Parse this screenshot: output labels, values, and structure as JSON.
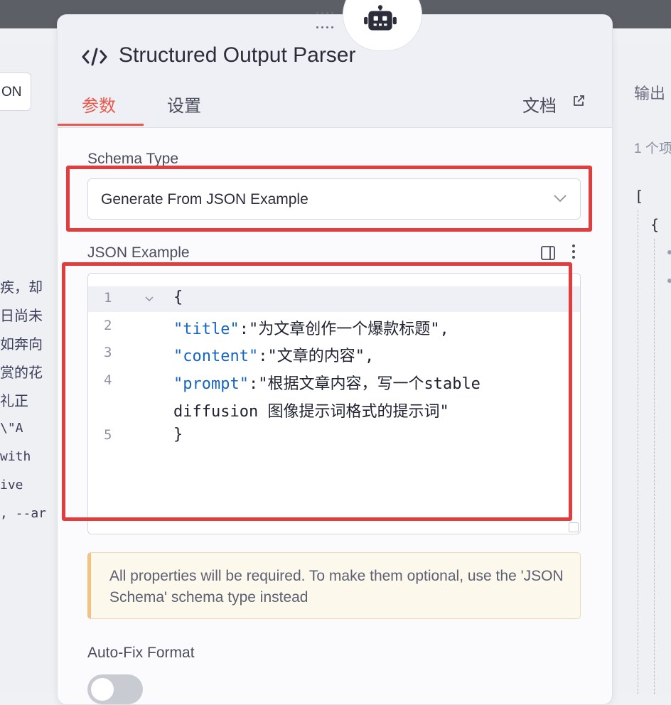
{
  "background": {
    "left_field_value": "ON",
    "left_text_lines": [
      "疾，却",
      "日尚未",
      "如奔向",
      "赏的花",
      "礼正",
      "\\\"A",
      "with",
      "ive",
      ", --ar"
    ],
    "right_panel_title": "输出",
    "right_panel_subtitle": "1 个项",
    "right_open_bracket": "[",
    "right_open_brace": "{"
  },
  "panel": {
    "title": "Structured Output Parser",
    "title_icon": "code-icon",
    "node_icon": "robot-icon",
    "tabs": [
      {
        "label": "参数",
        "active": true
      },
      {
        "label": "设置",
        "active": false
      }
    ],
    "docs_label": "文档",
    "docs_icon": "external-link-icon"
  },
  "schema_type": {
    "label": "Schema Type",
    "selected": "Generate From JSON Example"
  },
  "json_example": {
    "label": "JSON Example",
    "lines": [
      {
        "num": "1",
        "text": "{"
      },
      {
        "num": "2",
        "key": "\"title\"",
        "rest": ":\"为文章创作一个爆款标题\","
      },
      {
        "num": "3",
        "key": "\"content\"",
        "rest": ":\"文章的内容\","
      },
      {
        "num": "4",
        "key": "\"prompt\"",
        "rest": ":\"根据文章内容，写一个stable"
      },
      {
        "num": "",
        "text": "diffusion 图像提示词格式的提示词\""
      },
      {
        "num": "5",
        "text": "}"
      }
    ]
  },
  "notice": {
    "text": "All properties will be required. To make them optional, use the 'JSON Schema' schema type instead"
  },
  "auto_fix": {
    "label": "Auto-Fix Format",
    "enabled": false
  },
  "colors": {
    "accent": "#e9584a",
    "highlight_box": "#e23c3c",
    "json_key": "#1565c0",
    "notice_border": "#f1c383"
  }
}
